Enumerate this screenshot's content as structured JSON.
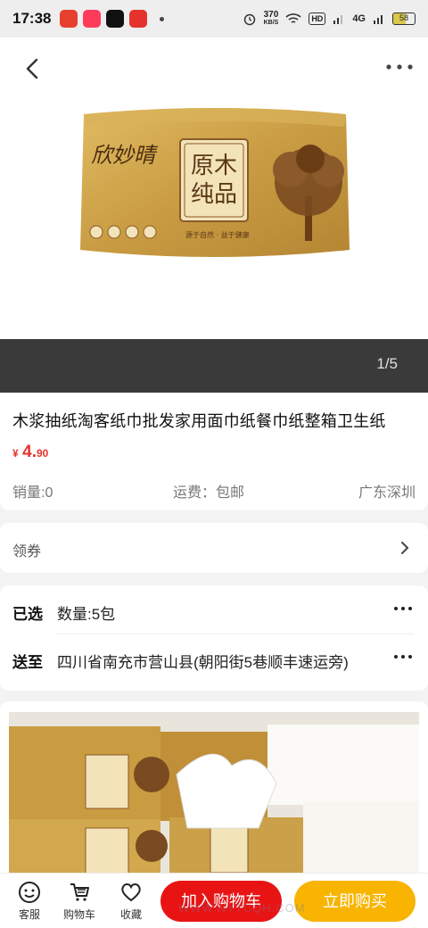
{
  "status_bar": {
    "time": "17:38",
    "net_speed_value": "370",
    "net_speed_unit": "KB/S",
    "hd": "HD",
    "signal": "4G",
    "battery": "58"
  },
  "gallery": {
    "index": "1/5",
    "brand_text": "欣妙晴",
    "badge_text": "原木纯品",
    "slogan": "源于自然 · 益于健康"
  },
  "product": {
    "title": "木浆抽纸淘客纸巾批发家用面巾纸餐巾纸整箱卫生纸",
    "price_symbol": "¥",
    "price_int": "4.",
    "price_dec": "90",
    "sales": "销量:0",
    "shipping": "运费：包邮",
    "location": "广东深圳"
  },
  "coupon": {
    "label": "领券"
  },
  "options": {
    "selected_key": "已选",
    "selected_value": "数量:5包",
    "ship_key": "送至",
    "ship_value": "四川省南充市营山县(朝阳街5巷顺丰速运旁)"
  },
  "bottom_bar": {
    "service": "客服",
    "cart": "购物车",
    "favorite": "收藏",
    "add_to_cart": "加入购物车",
    "buy_now": "立即购买"
  },
  "watermark": "WWW.NYTCQH.COM",
  "colors": {
    "accent_red": "#e81414",
    "buy_yellow": "#f8b400",
    "price_red": "#e4342d",
    "pack_gold": "#c9a04b"
  }
}
